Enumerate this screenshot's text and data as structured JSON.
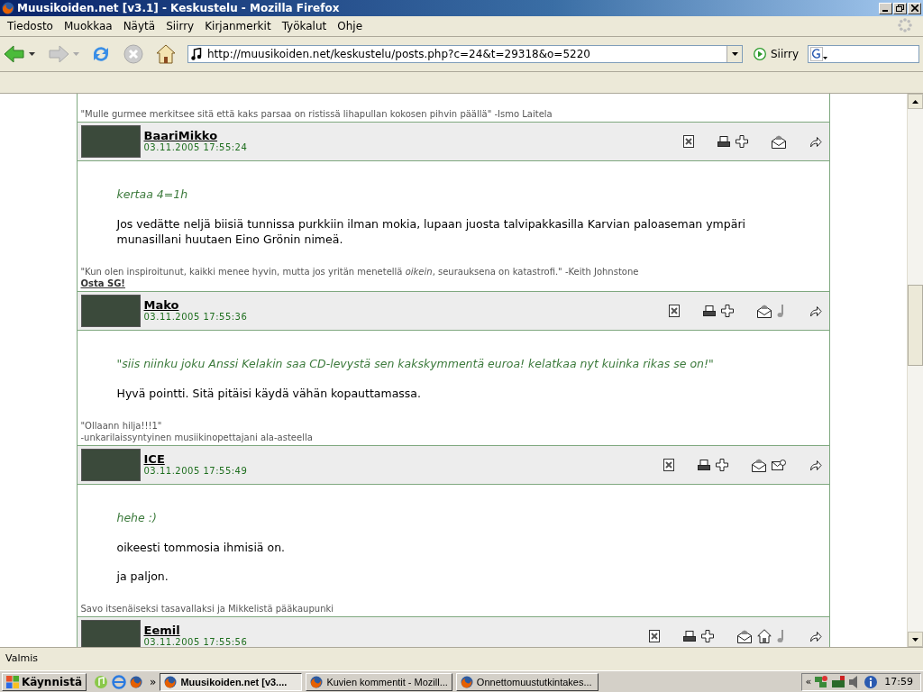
{
  "window": {
    "title": "Muusikoiden.net [v3.1] - Keskustelu - Mozilla Firefox"
  },
  "menu": [
    "Tiedosto",
    "Muokkaa",
    "Näytä",
    "Siirry",
    "Kirjanmerkit",
    "Työkalut",
    "Ohje"
  ],
  "toolbar": {
    "url": "http://muusikoiden.net/keskustelu/posts.php?c=24&t=29318&o=5220",
    "go": "Siirry"
  },
  "previous_signature": {
    "lines": [
      "\"Mulle gurmee merkitsee sitä että kaks parsaa on ristissä lihapullan kokosen pihvin päällä\" -Ismo Laitela"
    ]
  },
  "posts": [
    {
      "author": "BaariMikko",
      "date": "03.11.2005 17:55:24",
      "icons": [
        {
          "kind": "delete"
        },
        {
          "kind": "print"
        },
        {
          "kind": "add"
        },
        {
          "kind": "reply"
        },
        {
          "kind": "forward"
        }
      ],
      "quote": "kertaa 4=1h",
      "paragraphs": [
        "Jos vedätte neljä biisiä tunnissa purkkiin ilman mokia, lupaan juosta talvipakkasilla Karvian paloaseman ympäri munasillani huutaen Eino Grönin nimeä."
      ],
      "signature": {
        "lines": [
          "\"Kun olen inspiroitunut, kaikki menee hyvin, mutta jos yritän menetellä *oikein*, seurauksena on katastrofi.\" -Keith Johnstone"
        ],
        "link": "Osta SG!"
      }
    },
    {
      "author": "Mako",
      "date": "03.11.2005 17:55:36",
      "icons": [
        {
          "kind": "delete"
        },
        {
          "kind": "print"
        },
        {
          "kind": "add"
        },
        {
          "kind": "reply"
        },
        {
          "kind": "music"
        },
        {
          "kind": "forward"
        }
      ],
      "quote": "\"siis niinku joku Anssi Kelakin saa CD-levystä sen kakskymmentä euroa! kelatkaa nyt kuinka rikas se on!\"",
      "paragraphs": [
        "Hyvä pointti. Sitä pitäisi käydä vähän kopauttamassa."
      ],
      "signature": {
        "lines": [
          "\"Ollaann hilja!!!1\"",
          "-unkarilaissyntyinen musiikinopettajani ala-asteella"
        ]
      }
    },
    {
      "author": "ICE",
      "date": "03.11.2005 17:55:49",
      "icons": [
        {
          "kind": "delete"
        },
        {
          "kind": "print"
        },
        {
          "kind": "add"
        },
        {
          "kind": "reply"
        },
        {
          "kind": "email"
        },
        {
          "kind": "forward"
        }
      ],
      "quote": "hehe :)",
      "paragraphs": [
        "oikeesti tommosia ihmisiä on.",
        "ja paljon."
      ],
      "signature": {
        "lines": [
          "Savo itsenäiseksi tasavallaksi ja Mikkelistä pääkaupunki"
        ]
      }
    },
    {
      "author": "Eemil",
      "date": "03.11.2005 17:55:56",
      "icons": [
        {
          "kind": "delete"
        },
        {
          "kind": "print"
        },
        {
          "kind": "add"
        },
        {
          "kind": "reply"
        },
        {
          "kind": "home"
        },
        {
          "kind": "music"
        },
        {
          "kind": "forward"
        }
      ]
    }
  ],
  "status_bar": {
    "text": "Valmis"
  },
  "taskbar": {
    "start": "Käynnistä",
    "more": "»",
    "tasks": [
      {
        "label": "Muusikoiden.net [v3....",
        "selected": true
      },
      {
        "label": "Kuvien kommentit - Mozill...",
        "selected": false
      },
      {
        "label": "Onnettomuustutkintakes...",
        "selected": false
      }
    ],
    "tray_more": "«",
    "time": "17:59"
  }
}
